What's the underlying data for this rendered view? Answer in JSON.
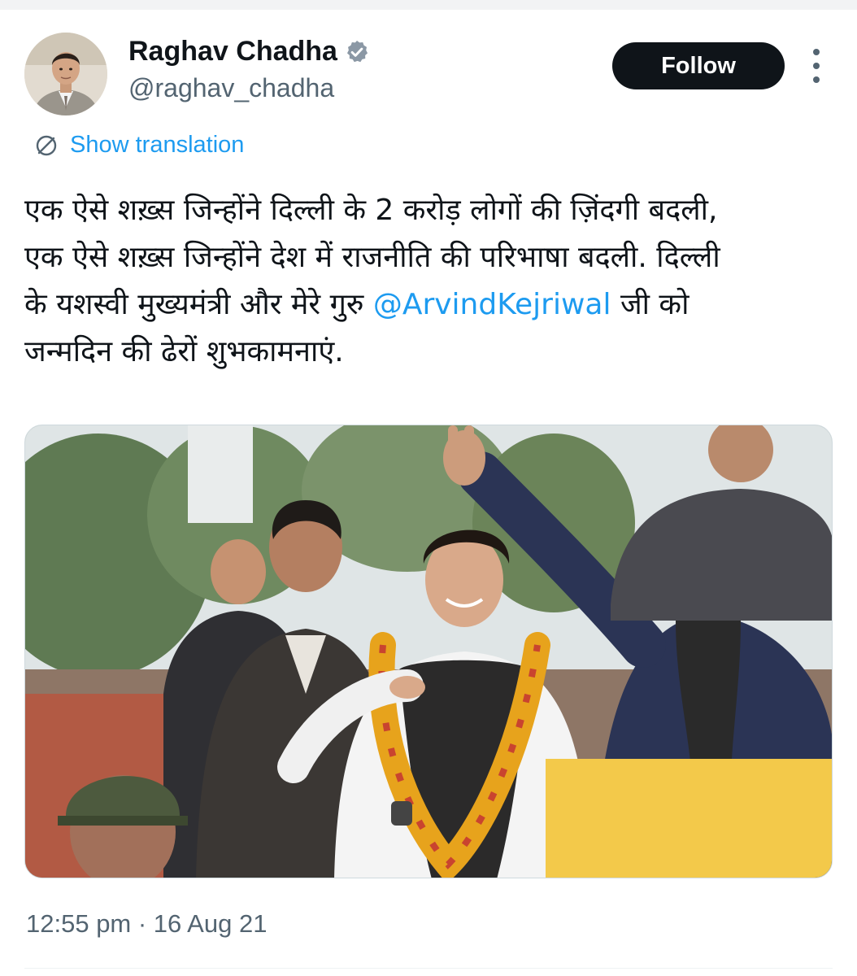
{
  "author": {
    "display_name": "Raghav Chadha",
    "handle": "@raghav_chadha",
    "verified": true,
    "verified_color": "#8b98a5"
  },
  "follow_button": {
    "label": "Follow"
  },
  "more_button": {
    "icon": "more-vertical-icon"
  },
  "translation": {
    "label": "Show translation",
    "icon": "translate-globe-icon"
  },
  "tweet": {
    "line1": "एक ऐसे शख़्स जिन्होंने दिल्ली के 2 करोड़ लोगों की ज़िंदगी बदली,",
    "line2": "एक ऐसे शख़्स जिन्होंने देश में राजनीति की परिभाषा बदली. दिल्ली",
    "line3_prefix": "के यशस्वी मुख्यमंत्री और मेरे गुरु ",
    "mention": "@ArvindKejriwal",
    "line3_suffix": " जी को",
    "line4": "जन्मदिन की ढेरों शुभकामनाएं."
  },
  "media": {
    "type": "photo"
  },
  "timestamp": "12:55 pm · 16 Aug 21",
  "colors": {
    "text": "#0f1419",
    "secondary": "#536471",
    "link": "#1d9bf0",
    "follow_bg": "#0f1419"
  }
}
